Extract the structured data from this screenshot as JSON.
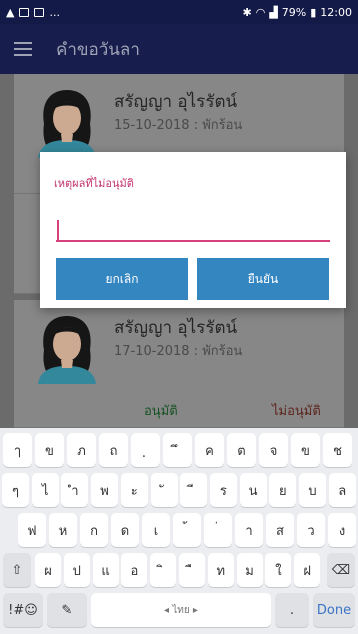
{
  "status_bar": {
    "left_icons": [
      "photo-icon",
      "photo-icon",
      "photo-icon"
    ],
    "left_more": "...",
    "battery": "79%",
    "time": "12:00"
  },
  "app_bar": {
    "title": "คำขอวันลา"
  },
  "cards": [
    {
      "name": "สรัญญา อุไรรัตน์",
      "date": "15-10-2018 : พักร้อน"
    },
    {
      "name": "สรัญญา อุไรรัตน์",
      "date": "17-10-2018 : พักร้อน",
      "approve": "อนุมัติ",
      "reject": "ไม่อนุมัติ"
    }
  ],
  "dialog": {
    "title": "เหตุผลที่ไม่อนุมัติ",
    "input_value": "",
    "cancel": "ยกเลิก",
    "confirm": "ยืนยัน"
  },
  "keyboard": {
    "row1": [
      "ๅ",
      "ข",
      "ภ",
      "ถ",
      "ฺ",
      "ึ",
      "ค",
      "ต",
      "จ",
      "ข",
      "ช"
    ],
    "row2": [
      "ๆ",
      "ไ",
      "ำ",
      "พ",
      "ะ",
      "ั",
      "ี",
      "ร",
      "น",
      "ย",
      "บ",
      "ล"
    ],
    "row3": [
      "ฟ",
      "ห",
      "ก",
      "ด",
      "เ",
      "้",
      "่",
      "า",
      "ส",
      "ว",
      "ง"
    ],
    "row4": [
      "ผ",
      "ป",
      "แ",
      "อ",
      "ิ",
      "ื",
      "ท",
      "ม",
      "ใ",
      "ฝ"
    ],
    "shift": "⇧",
    "backspace": "⌫",
    "symbols": "!#☺",
    "handwriting": "✎",
    "space": "◂ ไทย ▸",
    "period": ".",
    "done": "Done"
  }
}
